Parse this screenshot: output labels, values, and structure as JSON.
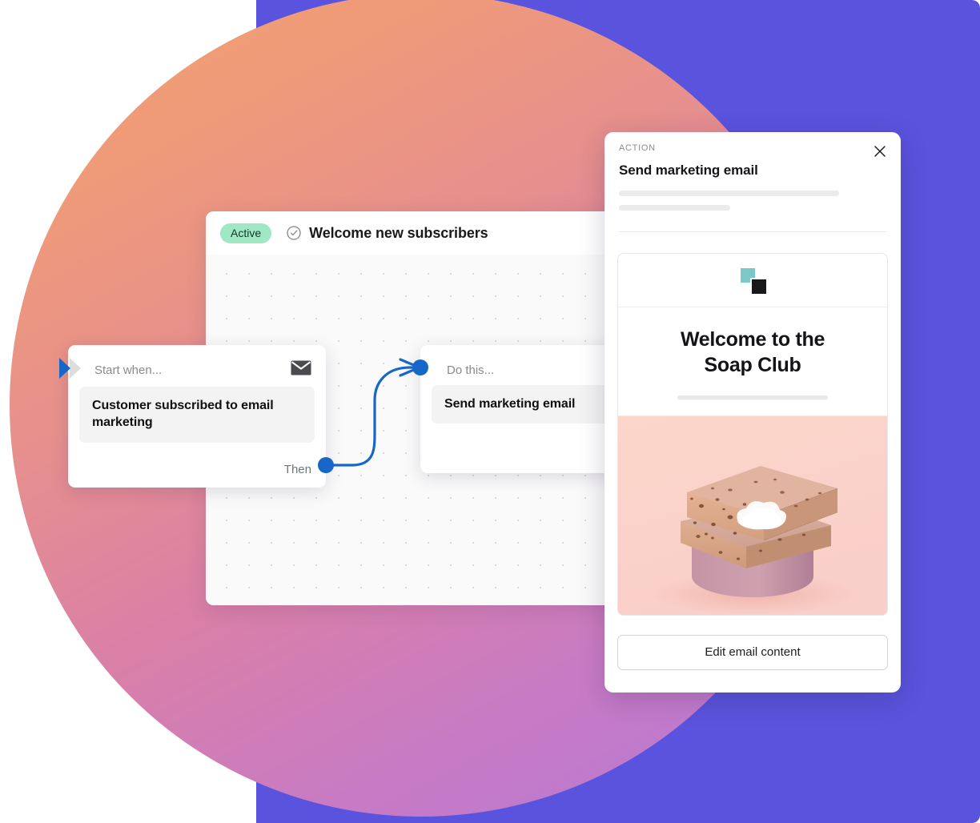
{
  "background": {
    "purple_color": "#5a53dd",
    "circle_gradient_from": "#f0a070",
    "circle_gradient_to": "#b478d8"
  },
  "workflow": {
    "status_badge": "Active",
    "status_icon": "check-circle-icon",
    "title": "Welcome new subscribers",
    "trigger_node": {
      "header_label": "Start when...",
      "icon": "envelope-icon",
      "value": "Customer subscribed to email marketing",
      "footer_label": "Then"
    },
    "action_node": {
      "header_label": "Do this...",
      "value": "Send marketing email"
    },
    "connector_color": "#1667c8"
  },
  "panel": {
    "kicker": "ACTION",
    "title": "Send marketing email",
    "close_icon": "close-icon",
    "email_preview": {
      "logo_icon": "brand-squares-logo",
      "logo_teal_color": "#7bc8c8",
      "logo_dark_color": "#17171c",
      "headline_line1": "Welcome to the",
      "headline_line2": "Soap Club",
      "image_alt": "soap-bars-on-pedestal"
    },
    "edit_button_label": "Edit email content"
  }
}
